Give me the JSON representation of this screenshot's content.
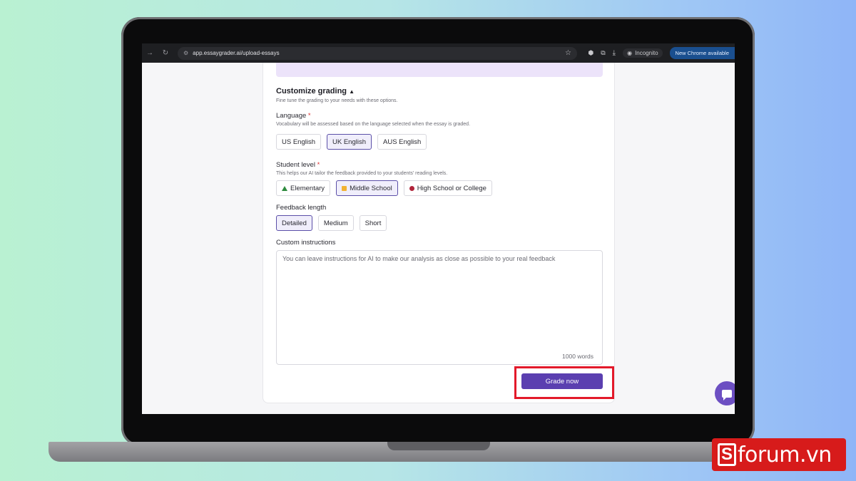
{
  "browser": {
    "url": "app.essaygrader.ai/upload-essays",
    "incognito_label": "Incognito",
    "update_label": "New Chrome available"
  },
  "customize": {
    "title": "Customize grading",
    "hint": "Fine tune the grading to your needs with these options."
  },
  "language": {
    "label": "Language",
    "required_mark": "*",
    "hint": "Vocabulary will be assessed based on the language selected when the essay is graded.",
    "options": [
      "US English",
      "UK English",
      "AUS English"
    ],
    "selected": "UK English"
  },
  "student_level": {
    "label": "Student level",
    "required_mark": "*",
    "hint": "This helps our AI tailor the feedback provided to your students' reading levels.",
    "options": [
      "Elementary",
      "Middle School",
      "High School or College"
    ],
    "selected": "Middle School"
  },
  "feedback_length": {
    "label": "Feedback length",
    "options": [
      "Detailed",
      "Medium",
      "Short"
    ],
    "selected": "Detailed"
  },
  "custom_instructions": {
    "label": "Custom instructions",
    "placeholder": "You can leave instructions for AI to make our analysis as close as possible to your real feedback",
    "word_limit": "1000 words"
  },
  "grade_button": {
    "label": "Grade now"
  },
  "watermark": {
    "brand": "forum.vn",
    "letter": "S"
  },
  "colors": {
    "accent": "#5b3fb0",
    "highlight": "#e3192a",
    "watermark": "#d71b1b"
  }
}
